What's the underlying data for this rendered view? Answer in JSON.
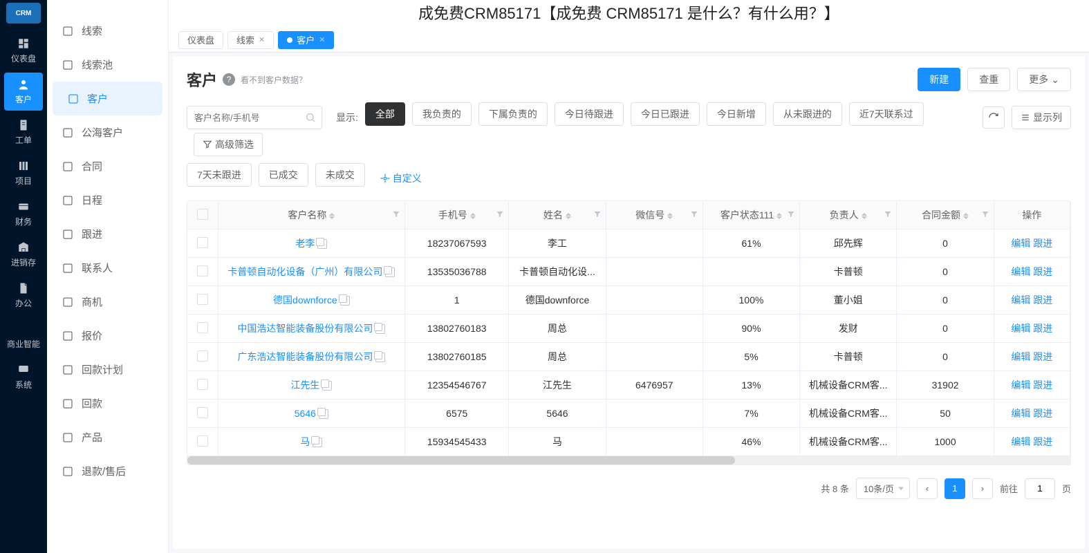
{
  "banner_text": "成免费CRM85171【成免费 CRM85171 是什么？有什么用？】",
  "rail": {
    "logo": "CRM",
    "items": [
      {
        "label": "仪表盘",
        "icon": "dashboard"
      },
      {
        "label": "客户",
        "icon": "user",
        "active": true
      },
      {
        "label": "工单",
        "icon": "ticket"
      },
      {
        "label": "项目",
        "icon": "project"
      },
      {
        "label": "财务",
        "icon": "finance"
      },
      {
        "label": "进销存",
        "icon": "inventory"
      },
      {
        "label": "办公",
        "icon": "office"
      },
      {
        "label": "商业智能",
        "icon": "bi"
      },
      {
        "label": "系统",
        "icon": "system"
      }
    ]
  },
  "sidebar": {
    "items": [
      {
        "label": "线索"
      },
      {
        "label": "线索池"
      },
      {
        "label": "客户",
        "active": true
      },
      {
        "label": "公海客户"
      },
      {
        "label": "合同"
      },
      {
        "label": "日程"
      },
      {
        "label": "跟进"
      },
      {
        "label": "联系人"
      },
      {
        "label": "商机"
      },
      {
        "label": "报价"
      },
      {
        "label": "回款计划"
      },
      {
        "label": "回款"
      },
      {
        "label": "产品"
      },
      {
        "label": "退款/售后"
      }
    ]
  },
  "tabs": {
    "items": [
      {
        "label": "仪表盘"
      },
      {
        "label": "线索",
        "closable": true
      },
      {
        "label": "客户",
        "closable": true,
        "active": true
      }
    ]
  },
  "page": {
    "title": "客户",
    "hint": "看不到客户数据？",
    "new_label": "新建",
    "reset_label": "查重",
    "more_label": "更多"
  },
  "search": {
    "placeholder": "客户名称/手机号"
  },
  "filter": {
    "show_label": "显示:",
    "chips": [
      "全部",
      "我负责的",
      "下属负责的",
      "今日待跟进",
      "今日已跟进",
      "今日新增",
      "从未跟进的",
      "近7天联系过",
      "7天未跟进",
      "已成交",
      "未成交"
    ],
    "active_chip": 0,
    "custom_label": "自定义",
    "columns_label": "显示列",
    "advanced_label": "高级筛选"
  },
  "table": {
    "columns": [
      "客户名称",
      "手机号",
      "姓名",
      "微信号",
      "客户状态111",
      "负责人",
      "合同金额",
      "操作"
    ],
    "rows": [
      {
        "name": "老李",
        "phone": "18237067593",
        "contact": "李工",
        "wechat": "",
        "status": "61%",
        "owner": "邱先辉",
        "amount": "0"
      },
      {
        "name": "卡普顿自动化设备（广州）有限公司",
        "phone": "13535036788",
        "contact": "卡普顿自动化设...",
        "wechat": "",
        "status": "",
        "owner": "卡普顿",
        "amount": "0"
      },
      {
        "name": "德国downforce",
        "phone": "1",
        "contact": "德国downforce",
        "wechat": "",
        "status": "100%",
        "owner": "董小姐",
        "amount": "0"
      },
      {
        "name": "中国浩达智能装备股份有限公司",
        "phone": "13802760183",
        "contact": "周总",
        "wechat": "",
        "status": "90%",
        "owner": "发财",
        "amount": "0"
      },
      {
        "name": "广东浩达智能装备股份有限公司",
        "phone": "13802760185",
        "contact": "周总",
        "wechat": "",
        "status": "5%",
        "owner": "卡普顿",
        "amount": "0"
      },
      {
        "name": "江先生",
        "phone": "12354546767",
        "contact": "江先生",
        "wechat": "6476957",
        "status": "13%",
        "owner": "机械设备CRM客...",
        "amount": "31902"
      },
      {
        "name": "5646",
        "phone": "6575",
        "contact": "5646",
        "wechat": "",
        "status": "7%",
        "owner": "机械设备CRM客...",
        "amount": "50"
      },
      {
        "name": "马",
        "phone": "15934545433",
        "contact": "马",
        "wechat": "",
        "status": "46%",
        "owner": "机械设备CRM客...",
        "amount": "1000"
      }
    ],
    "action_edit": "编辑",
    "action_follow": "跟进"
  },
  "pagination": {
    "total_text": "共 8 条",
    "per_page": "10条/页",
    "current": "1",
    "goto_label": "前往",
    "goto_value": "1",
    "page_suffix": "页"
  }
}
